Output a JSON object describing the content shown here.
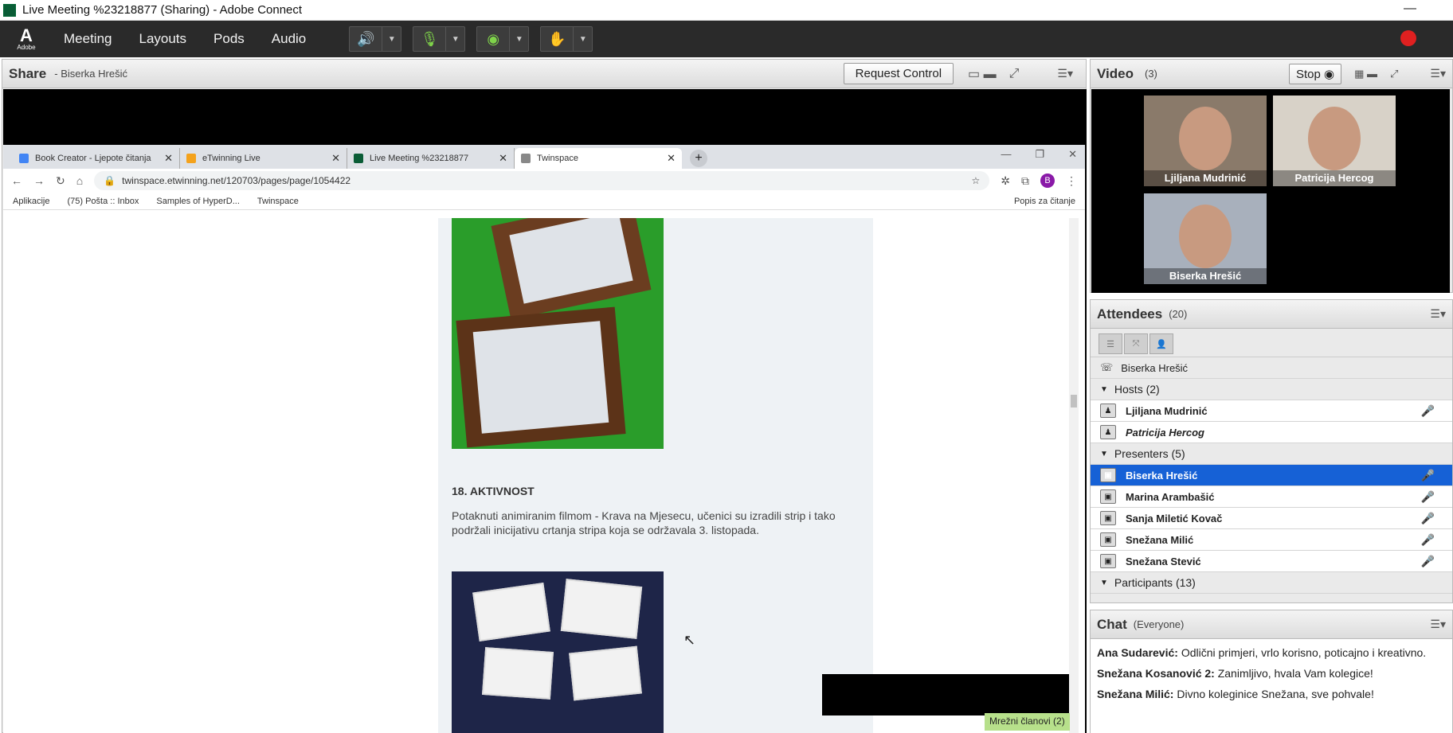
{
  "window": {
    "title": "Live Meeting %23218877 (Sharing) - Adobe Connect"
  },
  "menubar": {
    "logo_text": "Adobe",
    "items": [
      "Meeting",
      "Layouts",
      "Pods",
      "Audio"
    ]
  },
  "share": {
    "title": "Share",
    "presenter": "- Biserka Hrešić",
    "request_control": "Request Control"
  },
  "browser": {
    "tabs": [
      {
        "label": "Book Creator - Ljepote čitanja",
        "color": "#4285f4"
      },
      {
        "label": "eTwinning Live",
        "color": "#f4a21c"
      },
      {
        "label": "Live Meeting %23218877",
        "color": "#0a5c36"
      },
      {
        "label": "Twinspace",
        "color": "#888888"
      }
    ],
    "url": "twinspace.etwinning.net/120703/pages/page/1054422",
    "bookmarks": [
      "Aplikacije",
      "(75) Pošta :: Inbox",
      "Samples of HyperD...",
      "Twinspace"
    ],
    "reading_list": "Popis za čitanje",
    "avatar_letter": "B"
  },
  "content": {
    "heading": "18. AKTIVNOST",
    "paragraph": "Potaknuti animiranim filmom - Krava na Mjesecu, učenici su izradili strip i tako podržali inicijativu crtanja stripa koja se održavala 3. listopada.",
    "network_members": "Mrežni članovi (2)"
  },
  "video": {
    "title": "Video",
    "count": "(3)",
    "stop": "Stop",
    "participants": [
      "Ljiljana Mudrinić",
      "Patricija Hercog",
      "Biserka Hrešić"
    ]
  },
  "attendees": {
    "title": "Attendees",
    "count": "(20)",
    "me": "Biserka Hrešić",
    "hosts_label": "Hosts (2)",
    "hosts": [
      "Ljiljana Mudrinić",
      "Patricija Hercog"
    ],
    "presenters_label": "Presenters (5)",
    "presenters": [
      "Biserka Hrešić",
      "Marina Arambašić",
      "Sanja Miletić Kovač",
      "Snežana Milić",
      "Snežana Stević"
    ],
    "participants_label": "Participants (13)"
  },
  "chat": {
    "title": "Chat",
    "scope": "(Everyone)",
    "messages": [
      {
        "name": "Ana Sudarević:",
        "text": " Odlični primjeri, vrlo korisno, poticajno i kreativno."
      },
      {
        "name": "Snežana Kosanović 2:",
        "text": " Zanimljivo, hvala Vam kolegice!"
      },
      {
        "name": "Snežana Milić:",
        "text": " Divno koleginice Snežana, sve pohvale!"
      }
    ]
  },
  "colors": {
    "menubar": "#2a2a2a",
    "selection": "#1661d6",
    "record": "#e02020"
  }
}
